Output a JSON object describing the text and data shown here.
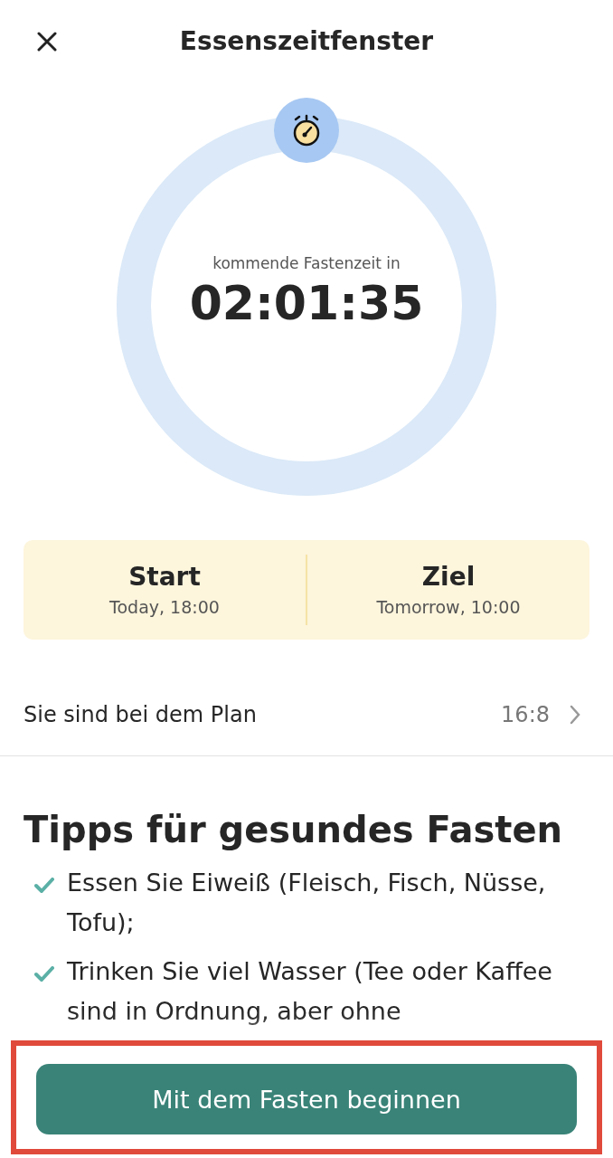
{
  "header": {
    "title": "Essenszeitfenster"
  },
  "timer": {
    "caption": "kommende Fastenzeit in",
    "time": "02:01:35"
  },
  "schedule": [
    {
      "label": "Start",
      "value": "Today, 18:00"
    },
    {
      "label": "Ziel",
      "value": "Tomorrow, 10:00"
    }
  ],
  "plan": {
    "label": "Sie sind bei dem Plan",
    "value": "16:8"
  },
  "tips": {
    "title": "Tipps für gesundes Fasten",
    "items": [
      "Essen Sie Eiweiß (Fleisch, Fisch, Nüsse, Tofu);",
      "Trinken Sie viel Wasser (Tee oder Kaffee sind in Ordnung, aber ohne"
    ]
  },
  "start_button": {
    "label": "Mit dem Fasten beginnen",
    "highlighted": true
  }
}
